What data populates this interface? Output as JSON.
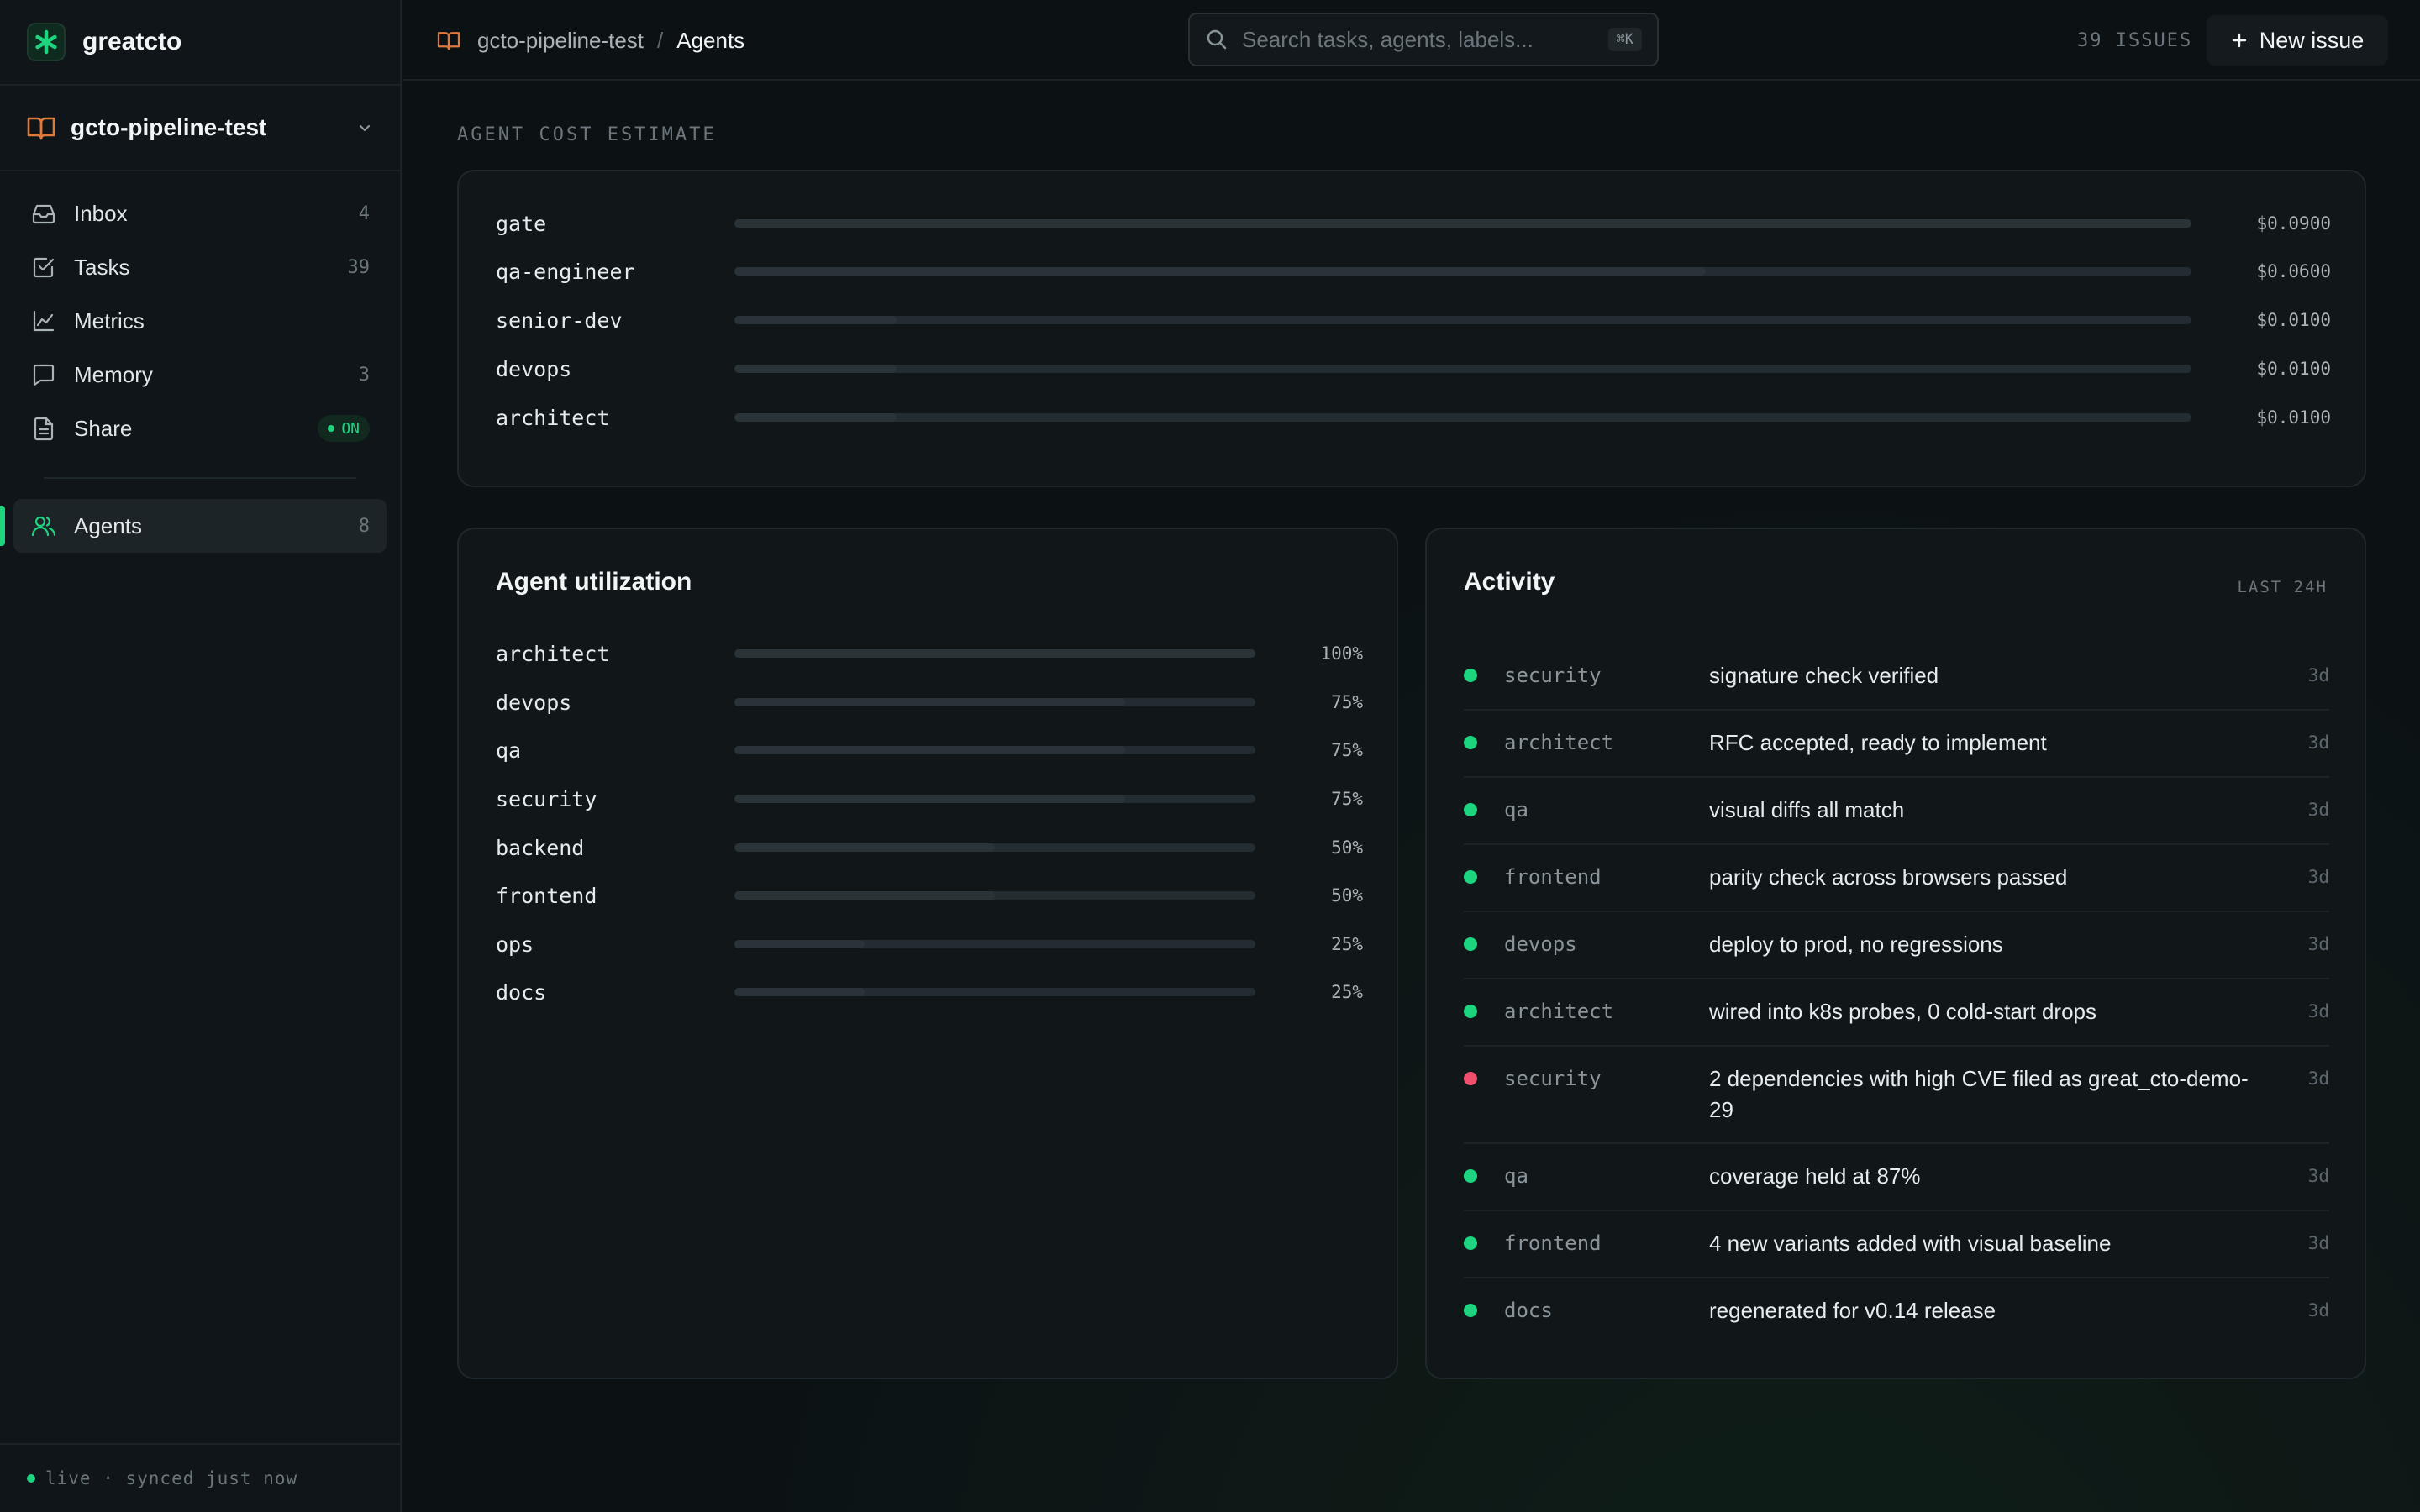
{
  "app": {
    "name": "greatcto"
  },
  "project": {
    "name": "gcto-pipeline-test"
  },
  "nav": {
    "items": [
      {
        "label": "Inbox",
        "count": "4"
      },
      {
        "label": "Tasks",
        "count": "39"
      },
      {
        "label": "Metrics",
        "count": ""
      },
      {
        "label": "Memory",
        "count": "3"
      },
      {
        "label": "Share",
        "badge": "ON"
      }
    ],
    "agents": {
      "label": "Agents",
      "count": "8"
    }
  },
  "footer": {
    "status": "live · synced just now"
  },
  "topbar": {
    "breadcrumb_project": "gcto-pipeline-test",
    "breadcrumb_sep": "/",
    "breadcrumb_current": "Agents",
    "search_placeholder": "Search tasks, agents, labels...",
    "search_shortcut": "⌘K",
    "issues_count": "39 ISSUES",
    "new_issue_label": "New issue"
  },
  "cost": {
    "label": "AGENT COST ESTIMATE",
    "rows": [
      {
        "agent": "gate",
        "value": "$0.0900",
        "amount": 0.09
      },
      {
        "agent": "qa-engineer",
        "value": "$0.0600",
        "amount": 0.06
      },
      {
        "agent": "senior-dev",
        "value": "$0.0100",
        "amount": 0.01
      },
      {
        "agent": "devops",
        "value": "$0.0100",
        "amount": 0.01
      },
      {
        "agent": "architect",
        "value": "$0.0100",
        "amount": 0.01
      }
    ]
  },
  "utilization": {
    "title": "Agent utilization",
    "rows": [
      {
        "agent": "architect",
        "value": "100%",
        "percent": 100
      },
      {
        "agent": "devops",
        "value": "75%",
        "percent": 75
      },
      {
        "agent": "qa",
        "value": "75%",
        "percent": 75
      },
      {
        "agent": "security",
        "value": "75%",
        "percent": 75
      },
      {
        "agent": "backend",
        "value": "50%",
        "percent": 50
      },
      {
        "agent": "frontend",
        "value": "50%",
        "percent": 50
      },
      {
        "agent": "ops",
        "value": "25%",
        "percent": 25
      },
      {
        "agent": "docs",
        "value": "25%",
        "percent": 25
      }
    ]
  },
  "activity": {
    "title": "Activity",
    "range": "LAST 24H",
    "colors": {
      "ok": "#1ed47f",
      "error": "#f0506e"
    },
    "rows": [
      {
        "agent": "security",
        "text": "signature check verified",
        "time": "3d",
        "status": "ok"
      },
      {
        "agent": "architect",
        "text": "RFC accepted, ready to implement",
        "time": "3d",
        "status": "ok"
      },
      {
        "agent": "qa",
        "text": "visual diffs all match",
        "time": "3d",
        "status": "ok"
      },
      {
        "agent": "frontend",
        "text": "parity check across browsers passed",
        "time": "3d",
        "status": "ok"
      },
      {
        "agent": "devops",
        "text": "deploy to prod, no regressions",
        "time": "3d",
        "status": "ok"
      },
      {
        "agent": "architect",
        "text": "wired into k8s probes, 0 cold-start drops",
        "time": "3d",
        "status": "ok"
      },
      {
        "agent": "security",
        "text": "2 dependencies with high CVE filed as great_cto-demo-29",
        "time": "3d",
        "status": "error"
      },
      {
        "agent": "qa",
        "text": "coverage held at 87%",
        "time": "3d",
        "status": "ok"
      },
      {
        "agent": "frontend",
        "text": "4 new variants added with visual baseline",
        "time": "3d",
        "status": "ok"
      },
      {
        "agent": "docs",
        "text": "regenerated for v0.14 release",
        "time": "3d",
        "status": "ok"
      }
    ]
  }
}
